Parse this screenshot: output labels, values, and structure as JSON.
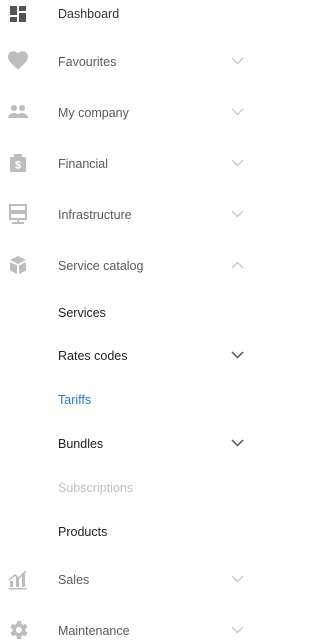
{
  "colors": {
    "icon": "#bdbdbd",
    "icon_dark": "#555555",
    "chevron_light": "#c8c8c8",
    "chevron_dark": "#555555",
    "active": "#2a7bc0",
    "disabled": "#c0c0c0"
  },
  "menu": {
    "dashboard": {
      "label": "Dashboard",
      "icon": "dashboard-icon"
    },
    "favourites": {
      "label": "Favourites",
      "icon": "heart-icon"
    },
    "my_company": {
      "label": "My company",
      "icon": "people-icon"
    },
    "financial": {
      "label": "Financial",
      "icon": "money-icon"
    },
    "infrastructure": {
      "label": "Infrastructure",
      "icon": "server-icon"
    },
    "service_catalog": {
      "label": "Service catalog",
      "icon": "box-icon",
      "expanded": true,
      "children": {
        "services": {
          "label": "Services"
        },
        "rates_codes": {
          "label": "Rates codes"
        },
        "tariffs": {
          "label": "Tariffs",
          "active": true
        },
        "bundles": {
          "label": "Bundles"
        },
        "subscriptions": {
          "label": "Subscriptions",
          "disabled": true
        },
        "products": {
          "label": "Products"
        }
      }
    },
    "sales": {
      "label": "Sales",
      "icon": "bar-chart-icon"
    },
    "maintenance": {
      "label": "Maintenance",
      "icon": "gear-icon"
    }
  }
}
